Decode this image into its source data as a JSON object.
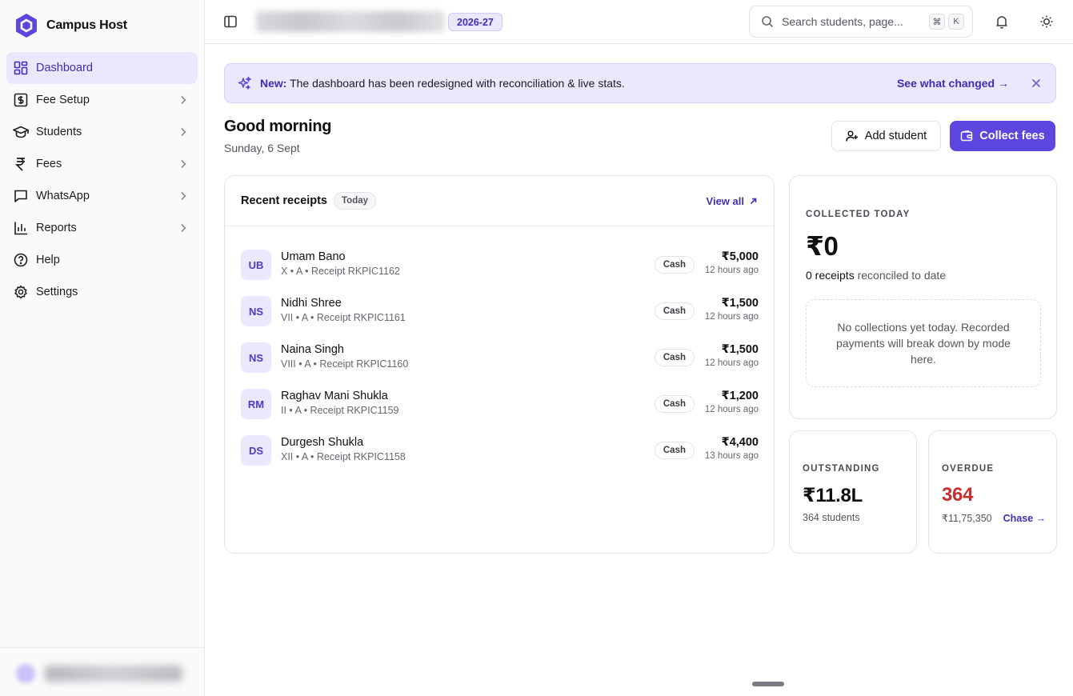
{
  "brand": {
    "name": "Campus Host",
    "accent": "#5b46e0"
  },
  "sidebar": {
    "items": [
      {
        "label": "Dashboard",
        "icon": "dashboard-grid-icon",
        "active": true,
        "has_chevron": false
      },
      {
        "label": "Fee Setup",
        "icon": "fee-setup-icon",
        "active": false,
        "has_chevron": true
      },
      {
        "label": "Students",
        "icon": "graduation-cap-icon",
        "active": false,
        "has_chevron": true
      },
      {
        "label": "Fees",
        "icon": "rupee-icon",
        "active": false,
        "has_chevron": true
      },
      {
        "label": "WhatsApp",
        "icon": "message-square-icon",
        "active": false,
        "has_chevron": true
      },
      {
        "label": "Reports",
        "icon": "bar-chart-icon",
        "active": false,
        "has_chevron": true
      },
      {
        "label": "Help",
        "icon": "help-circle-icon",
        "active": false,
        "has_chevron": false
      },
      {
        "label": "Settings",
        "icon": "gear-icon",
        "active": false,
        "has_chevron": false
      }
    ]
  },
  "topbar": {
    "academic_year": "2026-27",
    "search_placeholder": "Search students, page...",
    "kbd_mod": "⌘",
    "kbd_key": "K"
  },
  "banner": {
    "new_label": "New:",
    "message": "The dashboard has been redesigned with reconciliation & live stats.",
    "link": "See what changed →"
  },
  "greeting": {
    "title": "Good morning",
    "date": "Sunday, 6 Sept"
  },
  "actions": {
    "add_student": "Add student",
    "collect_fees": "Collect fees"
  },
  "receipts": {
    "title": "Recent receipts",
    "filter": "Today",
    "view_all": "View all",
    "rows": [
      {
        "initials": "UB",
        "name": "Umam Bano",
        "sub": "X • A • Receipt RKPIC1162",
        "mode": "Cash",
        "amount": "₹5,000",
        "time": "12 hours ago"
      },
      {
        "initials": "NS",
        "name": "Nidhi Shree",
        "sub": "VII • A • Receipt RKPIC1161",
        "mode": "Cash",
        "amount": "₹1,500",
        "time": "12 hours ago"
      },
      {
        "initials": "NS",
        "name": "Naina Singh",
        "sub": "VIII • A • Receipt RKPIC1160",
        "mode": "Cash",
        "amount": "₹1,500",
        "time": "12 hours ago"
      },
      {
        "initials": "RM",
        "name": "Raghav Mani Shukla",
        "sub": "II • A • Receipt RKPIC1159",
        "mode": "Cash",
        "amount": "₹1,200",
        "time": "12 hours ago"
      },
      {
        "initials": "DS",
        "name": "Durgesh Shukla",
        "sub": "XII • A • Receipt RKPIC1158",
        "mode": "Cash",
        "amount": "₹4,400",
        "time": "13 hours ago"
      }
    ]
  },
  "collected_today": {
    "label": "COLLECTED TODAY",
    "amount": "₹0",
    "receipts_count": "0 receipts",
    "receipts_suffix": "reconciled to date",
    "empty_message": "No collections yet today. Recorded payments will break down by mode here."
  },
  "outstanding": {
    "label": "OUTSTANDING",
    "amount": "₹11.8L",
    "sub": "364 students"
  },
  "overdue": {
    "label": "OVERDUE",
    "count": "364",
    "amount": "₹11,75,350",
    "chase": "Chase →",
    "color": "#c62f2f"
  }
}
